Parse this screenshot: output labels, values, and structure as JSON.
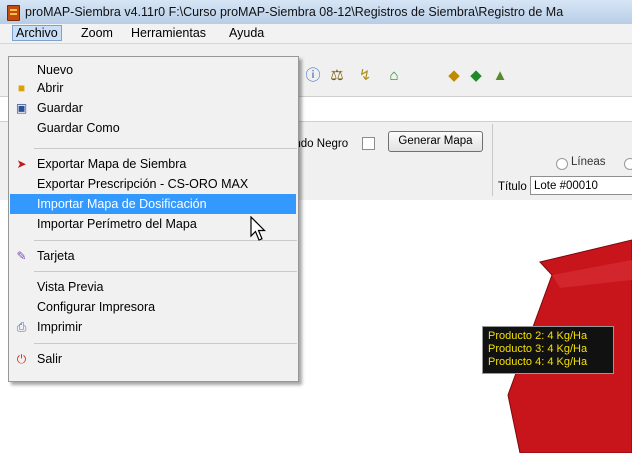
{
  "window": {
    "title": "proMAP-Siembra v4.11r0   F:\\Curso proMAP-Siembra 08-12\\Registros de Siembra\\Registro de Ma"
  },
  "menubar": {
    "items": [
      "Archivo",
      "Zoom",
      "Herramientas",
      "Ayuda"
    ]
  },
  "toolbar": {
    "icons": [
      "info-icon",
      "scale-icon",
      "tool-icon",
      "house-icon",
      "marker-icon",
      "marker-icon",
      "marker-icon"
    ]
  },
  "dropdown": {
    "items": [
      {
        "label": "Nuevo",
        "icon": ""
      },
      {
        "label": "Abrir",
        "icon": "open-folder-icon"
      },
      {
        "label": "Guardar",
        "icon": "save-disk-icon"
      },
      {
        "label": "Guardar Como",
        "icon": ""
      },
      {
        "label": "Exportar Mapa de Siembra",
        "icon": "export-icon"
      },
      {
        "label": "Exportar Prescripción - CS-ORO MAX",
        "icon": ""
      },
      {
        "label": "Importar Mapa de Dosificación",
        "icon": "",
        "highlighted": true
      },
      {
        "label": "Importar Perímetro del Mapa",
        "icon": ""
      },
      {
        "label": "Tarjeta",
        "icon": "card-icon"
      },
      {
        "label": "Vista Previa",
        "icon": ""
      },
      {
        "label": "Configurar Impresora",
        "icon": ""
      },
      {
        "label": "Imprimir",
        "icon": "printer-icon"
      },
      {
        "label": "Salir",
        "icon": "exit-icon"
      }
    ]
  },
  "panel": {
    "dark_background_label": "ondo Negro",
    "generate_button": "Generar Mapa",
    "lines_label": "Líneas",
    "title_label": "Título",
    "title_value": "Lote #00010"
  },
  "tooltip": {
    "lines": [
      "Producto 2: 4 Kg/Ha",
      "Producto 3: 4 Kg/Ha",
      "Producto 4: 4 Kg/Ha"
    ]
  },
  "colors": {
    "map_fill": "#c8141b",
    "highlight": "#3399ff",
    "tooltip_text": "#f4e000",
    "tooltip_background": "#111111"
  }
}
